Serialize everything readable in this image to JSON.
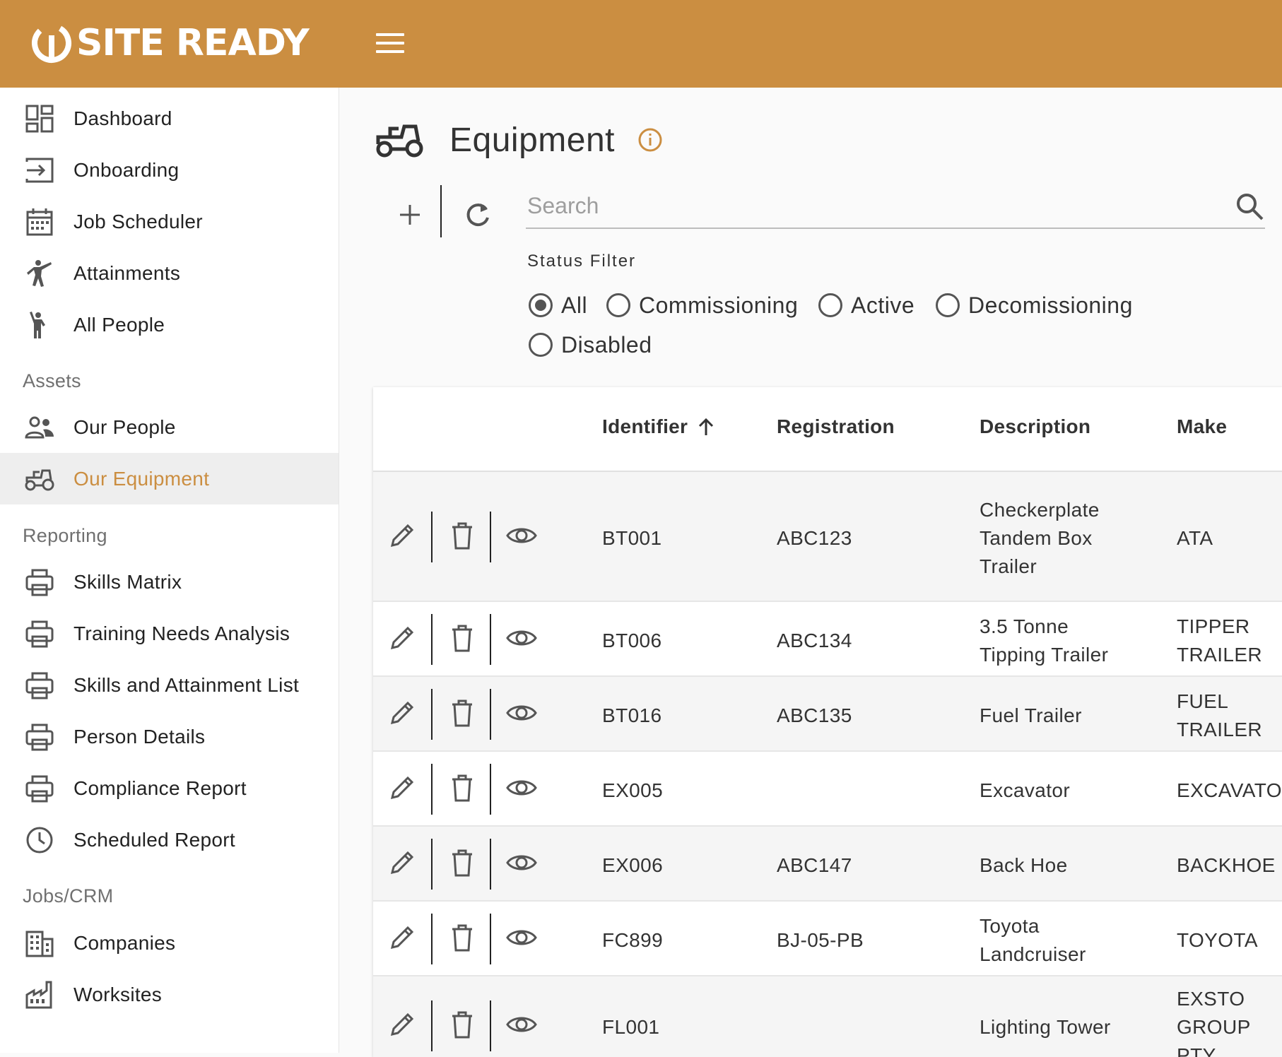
{
  "app": {
    "brand": "SITE READY",
    "brand_color": "#cb8e41",
    "menu_icon": "hamburger-menu-icon"
  },
  "sidebar": {
    "items": [
      {
        "label": "Dashboard",
        "icon": "dashboard-icon"
      },
      {
        "label": "Onboarding",
        "icon": "login-arrow-icon"
      },
      {
        "label": "Job Scheduler",
        "icon": "calendar-icon"
      },
      {
        "label": "Attainments",
        "icon": "karate-person-icon"
      },
      {
        "label": "All People",
        "icon": "person-waving-icon"
      }
    ],
    "sections": {
      "assets": "Assets",
      "reporting": "Reporting",
      "jobs": "Jobs/CRM"
    },
    "assets_items": [
      {
        "label": "Our People",
        "icon": "people-group-icon"
      },
      {
        "label": "Our Equipment",
        "icon": "tractor-icon",
        "active": true
      }
    ],
    "reporting_items": [
      {
        "label": "Skills Matrix",
        "icon": "printer-icon"
      },
      {
        "label": "Training Needs Analysis",
        "icon": "printer-icon"
      },
      {
        "label": "Skills and Attainment List",
        "icon": "printer-icon"
      },
      {
        "label": "Person Details",
        "icon": "printer-icon"
      },
      {
        "label": "Compliance Report",
        "icon": "printer-icon"
      },
      {
        "label": "Scheduled Report",
        "icon": "clock-icon"
      }
    ],
    "jobs_items": [
      {
        "label": "Companies",
        "icon": "building-icon"
      },
      {
        "label": "Worksites",
        "icon": "factory-icon"
      }
    ]
  },
  "main": {
    "title": "Equipment",
    "title_icon": "tractor-icon",
    "info_icon": "info-icon",
    "search": {
      "placeholder": "Search",
      "value": ""
    },
    "filter": {
      "label": "Status Filter",
      "options": [
        "All",
        "Commissioning",
        "Active",
        "Decomissioning",
        "Disabled"
      ],
      "selected": "All"
    },
    "table": {
      "columns": [
        "Identifier",
        "Registration",
        "Description",
        "Make"
      ],
      "sort": {
        "column": "Identifier",
        "direction": "ascending"
      },
      "rows": [
        {
          "identifier": "BT001",
          "registration": "ABC123",
          "description": "Checkerplate\nTandem Box\nTrailer",
          "make": "ATA"
        },
        {
          "identifier": "BT006",
          "registration": "ABC134",
          "description": "3.5 Tonne\nTipping Trailer",
          "make": "TIPPER\nTRAILER"
        },
        {
          "identifier": "BT016",
          "registration": "ABC135",
          "description": "Fuel Trailer",
          "make": "FUEL\nTRAILER"
        },
        {
          "identifier": "EX005",
          "registration": "",
          "description": "Excavator",
          "make": "EXCAVATOR"
        },
        {
          "identifier": "EX006",
          "registration": "ABC147",
          "description": "Back Hoe",
          "make": "BACKHOE"
        },
        {
          "identifier": "FC899",
          "registration": "BJ-05-PB",
          "description": "Toyota\nLandcruiser",
          "make": "TOYOTA"
        },
        {
          "identifier": "FL001",
          "registration": "",
          "description": "Lighting Tower",
          "make": "EXSTO\nGROUP PTY\nLTD"
        }
      ]
    }
  }
}
